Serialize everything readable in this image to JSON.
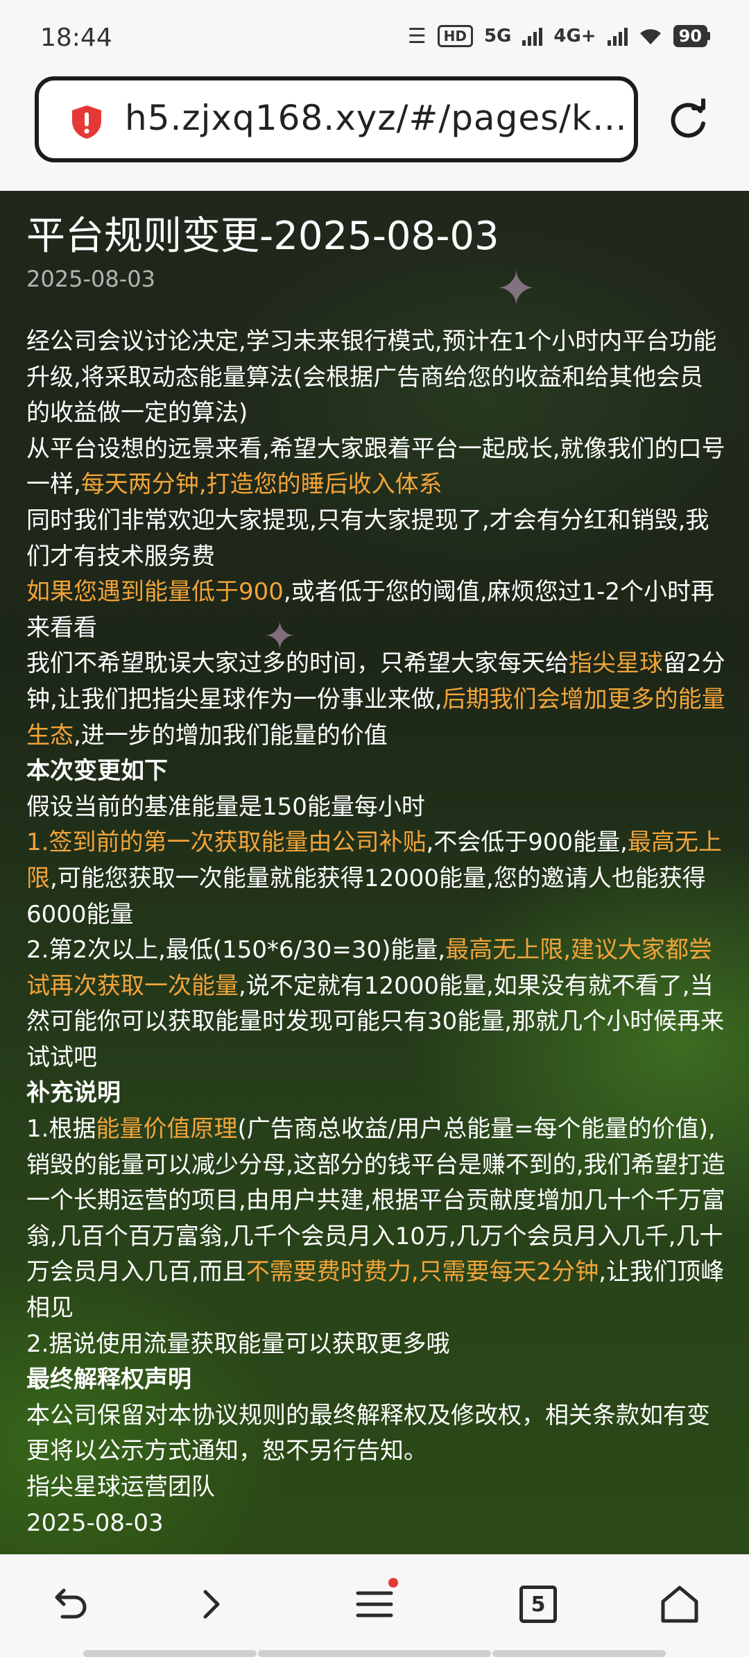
{
  "status_bar": {
    "time": "18:44",
    "battery": "90",
    "hd_label": "HD",
    "net_5g": "5G",
    "net_4g": "4G+"
  },
  "address_bar": {
    "url": "h5.zjxq168.xyz/#/pages/k…",
    "security_icon": "shield-warning-icon",
    "refresh_icon": "refresh-icon"
  },
  "article": {
    "title": "平台规则变更-2025-08-03",
    "date": "2025-08-03",
    "p1": "经公司会议讨论决定,学习未来银行模式,预计在1个小时内平台功能升级,将采取动态能量算法(会根据广告商给您的收益和给其他会员的收益做一定的算法)",
    "p2a": "从平台设想的远景来看,希望大家跟着平台一起成长,就像我们的口号一样,",
    "p2b": "每天两分钟,打造您的睡后收入体系",
    "p3": "同时我们非常欢迎大家提现,只有大家提现了,才会有分红和销毁,我们才有技术服务费",
    "p4a": "如果您遇到能量低于900",
    "p4b": ",或者低于您的阈值,麻烦您过1-2个小时再来看看",
    "p5a": "我们不希望耽误大家过多的时间，只希望大家每天给",
    "p5b": "指尖星球",
    "p5c": "留2分钟,让我们把指尖星球作为一份事业来做,",
    "p5d": "后期我们会增加更多的能量生态",
    "p5e": ",进一步的增加我们能量的价值",
    "h1": "本次变更如下",
    "p6": "假设当前的基准能量是150能量每小时",
    "p7a": "1.",
    "p7b": "签到前的第一次获取能量由公司补贴",
    "p7c": ",不会低于900能量,",
    "p7d": "最高无上限",
    "p7e": ",可能您获取一次能量就能获得12000能量,您的邀请人也能获得6000能量",
    "p8a": "2.第2次以上,最低(150*6/30=30)能量,",
    "p8b": "最高无上限,建议大家都尝试再次获取一次能量",
    "p8c": ",说不定就有12000能量,如果没有就不看了,当然可能你可以获取能量时发现可能只有30能量,那就几个小时候再来试试吧",
    "h2": "补充说明",
    "p9a": "1.根据",
    "p9b": "能量价值原理",
    "p9c": "(广告商总收益/用户总能量=每个能量的价值),销毁的能量可以减少分母,这部分的钱平台是赚不到的,我们希望打造一个长期运营的项目,由用户共建,根据平台贡献度增加几十个千万富翁,几百个百万富翁,几千个会员月入10万,几万个会员月入几千,几十万会员月入几百,而且",
    "p9d": "不需要费时费力,只需要每天2分钟",
    "p9e": ",让我们顶峰相见",
    "p10": "2.据说使用流量获取能量可以获取更多哦",
    "h3": "最终解释权声明",
    "p11": "本公司保留对本协议规则的最终解释权及修改权，相关条款如有变更将以公示方式通知，恕不另行告知。",
    "p12": "指尖星球运营团队",
    "p13": "2025-08-03"
  },
  "bottom_nav": {
    "tab_count": "5",
    "icons": [
      "back-icon",
      "forward-icon",
      "menu-icon",
      "tabs-icon",
      "home-icon"
    ]
  },
  "colors": {
    "highlight": "#f2a43a",
    "text": "#ffffff",
    "date": "#b5b5b5",
    "chrome": "#f7f7f7"
  }
}
